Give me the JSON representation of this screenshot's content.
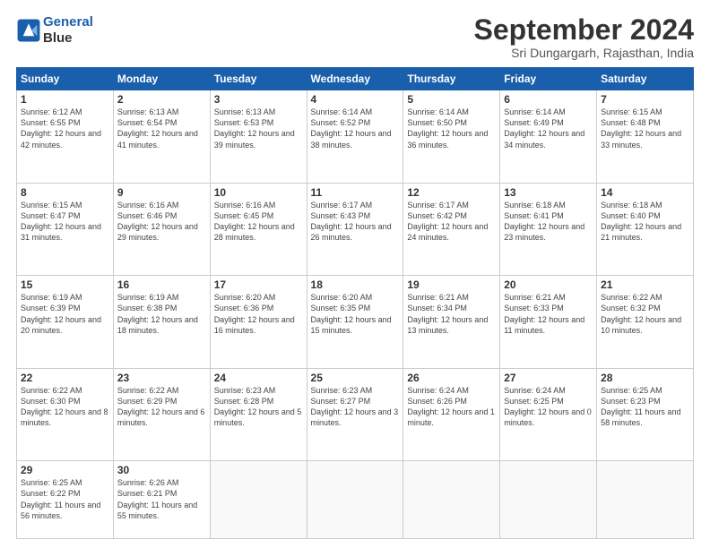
{
  "header": {
    "logo_line1": "General",
    "logo_line2": "Blue",
    "month": "September 2024",
    "location": "Sri Dungargarh, Rajasthan, India"
  },
  "weekdays": [
    "Sunday",
    "Monday",
    "Tuesday",
    "Wednesday",
    "Thursday",
    "Friday",
    "Saturday"
  ],
  "weeks": [
    [
      {
        "day": "1",
        "rise": "6:12 AM",
        "set": "6:55 PM",
        "daylight": "12 hours and 42 minutes."
      },
      {
        "day": "2",
        "rise": "6:13 AM",
        "set": "6:54 PM",
        "daylight": "12 hours and 41 minutes."
      },
      {
        "day": "3",
        "rise": "6:13 AM",
        "set": "6:53 PM",
        "daylight": "12 hours and 39 minutes."
      },
      {
        "day": "4",
        "rise": "6:14 AM",
        "set": "6:52 PM",
        "daylight": "12 hours and 38 minutes."
      },
      {
        "day": "5",
        "rise": "6:14 AM",
        "set": "6:50 PM",
        "daylight": "12 hours and 36 minutes."
      },
      {
        "day": "6",
        "rise": "6:14 AM",
        "set": "6:49 PM",
        "daylight": "12 hours and 34 minutes."
      },
      {
        "day": "7",
        "rise": "6:15 AM",
        "set": "6:48 PM",
        "daylight": "12 hours and 33 minutes."
      }
    ],
    [
      {
        "day": "8",
        "rise": "6:15 AM",
        "set": "6:47 PM",
        "daylight": "12 hours and 31 minutes."
      },
      {
        "day": "9",
        "rise": "6:16 AM",
        "set": "6:46 PM",
        "daylight": "12 hours and 29 minutes."
      },
      {
        "day": "10",
        "rise": "6:16 AM",
        "set": "6:45 PM",
        "daylight": "12 hours and 28 minutes."
      },
      {
        "day": "11",
        "rise": "6:17 AM",
        "set": "6:43 PM",
        "daylight": "12 hours and 26 minutes."
      },
      {
        "day": "12",
        "rise": "6:17 AM",
        "set": "6:42 PM",
        "daylight": "12 hours and 24 minutes."
      },
      {
        "day": "13",
        "rise": "6:18 AM",
        "set": "6:41 PM",
        "daylight": "12 hours and 23 minutes."
      },
      {
        "day": "14",
        "rise": "6:18 AM",
        "set": "6:40 PM",
        "daylight": "12 hours and 21 minutes."
      }
    ],
    [
      {
        "day": "15",
        "rise": "6:19 AM",
        "set": "6:39 PM",
        "daylight": "12 hours and 20 minutes."
      },
      {
        "day": "16",
        "rise": "6:19 AM",
        "set": "6:38 PM",
        "daylight": "12 hours and 18 minutes."
      },
      {
        "day": "17",
        "rise": "6:20 AM",
        "set": "6:36 PM",
        "daylight": "12 hours and 16 minutes."
      },
      {
        "day": "18",
        "rise": "6:20 AM",
        "set": "6:35 PM",
        "daylight": "12 hours and 15 minutes."
      },
      {
        "day": "19",
        "rise": "6:21 AM",
        "set": "6:34 PM",
        "daylight": "12 hours and 13 minutes."
      },
      {
        "day": "20",
        "rise": "6:21 AM",
        "set": "6:33 PM",
        "daylight": "12 hours and 11 minutes."
      },
      {
        "day": "21",
        "rise": "6:22 AM",
        "set": "6:32 PM",
        "daylight": "12 hours and 10 minutes."
      }
    ],
    [
      {
        "day": "22",
        "rise": "6:22 AM",
        "set": "6:30 PM",
        "daylight": "12 hours and 8 minutes."
      },
      {
        "day": "23",
        "rise": "6:22 AM",
        "set": "6:29 PM",
        "daylight": "12 hours and 6 minutes."
      },
      {
        "day": "24",
        "rise": "6:23 AM",
        "set": "6:28 PM",
        "daylight": "12 hours and 5 minutes."
      },
      {
        "day": "25",
        "rise": "6:23 AM",
        "set": "6:27 PM",
        "daylight": "12 hours and 3 minutes."
      },
      {
        "day": "26",
        "rise": "6:24 AM",
        "set": "6:26 PM",
        "daylight": "12 hours and 1 minute."
      },
      {
        "day": "27",
        "rise": "6:24 AM",
        "set": "6:25 PM",
        "daylight": "12 hours and 0 minutes."
      },
      {
        "day": "28",
        "rise": "6:25 AM",
        "set": "6:23 PM",
        "daylight": "11 hours and 58 minutes."
      }
    ],
    [
      {
        "day": "29",
        "rise": "6:25 AM",
        "set": "6:22 PM",
        "daylight": "11 hours and 56 minutes."
      },
      {
        "day": "30",
        "rise": "6:26 AM",
        "set": "6:21 PM",
        "daylight": "11 hours and 55 minutes."
      },
      null,
      null,
      null,
      null,
      null
    ]
  ],
  "labels": {
    "sunrise": "Sunrise:",
    "sunset": "Sunset:",
    "daylight": "Daylight:"
  }
}
